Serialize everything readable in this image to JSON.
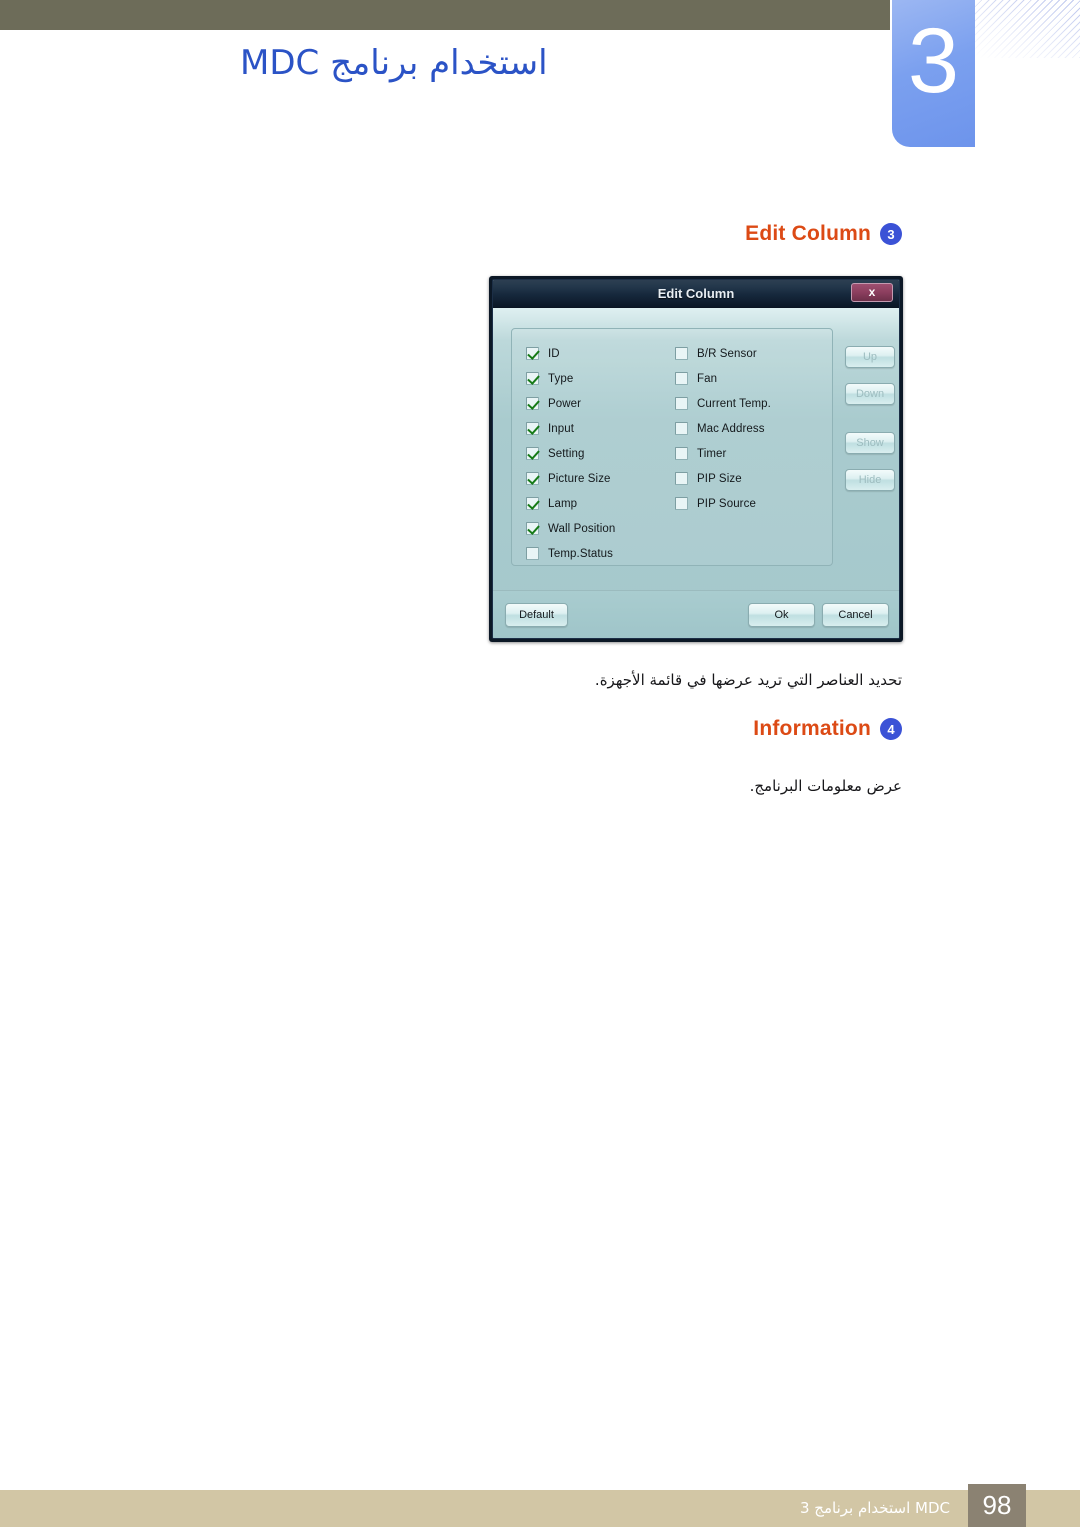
{
  "header": {
    "chapter_number": "3",
    "title": "استخدام برنامج MDC"
  },
  "sections": [
    {
      "label": "Edit Column",
      "badge": "3",
      "note": "تحديد العناصر التي تريد عرضها في قائمة الأجهزة."
    },
    {
      "label": "Information",
      "badge": "4",
      "note": "عرض معلومات البرنامج."
    }
  ],
  "dialog": {
    "title": "Edit Column",
    "close_label": "x",
    "columns_left": [
      {
        "label": "ID",
        "checked": true
      },
      {
        "label": "Type",
        "checked": true
      },
      {
        "label": "Power",
        "checked": true
      },
      {
        "label": "Input",
        "checked": true
      },
      {
        "label": "Setting",
        "checked": true
      },
      {
        "label": "Picture Size",
        "checked": true
      },
      {
        "label": "Lamp",
        "checked": true
      },
      {
        "label": "Wall Position",
        "checked": true
      },
      {
        "label": "Temp.Status",
        "checked": false
      }
    ],
    "columns_right": [
      {
        "label": "B/R Sensor",
        "checked": false
      },
      {
        "label": "Fan",
        "checked": false
      },
      {
        "label": "Current Temp.",
        "checked": false
      },
      {
        "label": "Mac Address",
        "checked": false
      },
      {
        "label": "Timer",
        "checked": false
      },
      {
        "label": "PIP Size",
        "checked": false
      },
      {
        "label": "PIP Source",
        "checked": false
      }
    ],
    "side_buttons": [
      {
        "label": "Up",
        "disabled": true
      },
      {
        "label": "Down",
        "disabled": true
      },
      {
        "label": "Show",
        "disabled": true
      },
      {
        "label": "Hide",
        "disabled": true
      }
    ],
    "footer_buttons": {
      "default_label": "Default",
      "ok_label": "Ok",
      "cancel_label": "Cancel"
    }
  },
  "footer": {
    "page_number": "98",
    "text": "MDC استخدام برنامج 3"
  },
  "colors": {
    "header_bar": "#6d6c59",
    "chapter_box": "#7ba0ef",
    "title_blue": "#2b53c6",
    "section_orange": "#dc4a15",
    "badge_blue": "#3b52d6",
    "footer_band": "#d2c6a5",
    "footer_pagebox": "#8b8272",
    "dialog_body": "#a9cbce",
    "dialog_titlebar": "#16283c",
    "close_button": "#8c3f5f",
    "checkmark_green": "#157a16"
  }
}
